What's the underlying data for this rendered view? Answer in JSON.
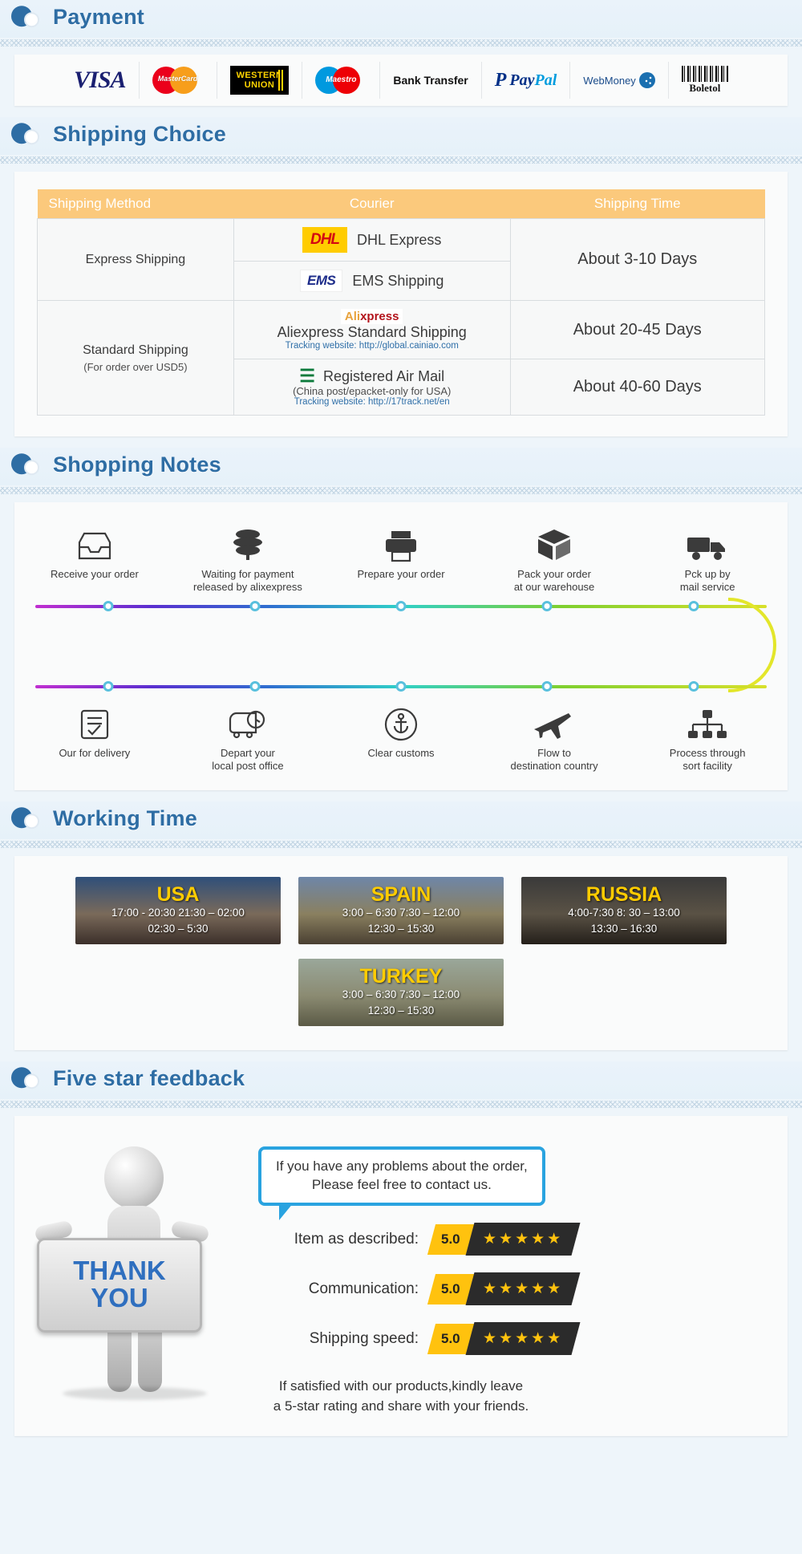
{
  "sections": {
    "payment": {
      "title": "Payment"
    },
    "shipping": {
      "title": "Shipping Choice"
    },
    "notes": {
      "title": "Shopping Notes"
    },
    "working": {
      "title": "Working Time"
    },
    "feedback": {
      "title": "Five star feedback"
    }
  },
  "payment": {
    "methods": [
      {
        "name": "visa-logo",
        "label": "VISA"
      },
      {
        "name": "mastercard-logo",
        "label": "MasterCard"
      },
      {
        "name": "western-union-logo",
        "label": "WESTERN UNION",
        "line1": "WESTERN",
        "line2": "UNION"
      },
      {
        "name": "maestro-logo",
        "label": "Maestro"
      },
      {
        "name": "bank-transfer-logo",
        "label": "Bank Transfer"
      },
      {
        "name": "paypal-logo",
        "label": "PayPal",
        "mark": "P",
        "part1": "Pay",
        "part2": "Pal"
      },
      {
        "name": "webmoney-logo",
        "label": "WebMoney"
      },
      {
        "name": "boleto-logo",
        "label": "Boletol"
      }
    ]
  },
  "shipping_table": {
    "headers": [
      "Shipping Method",
      "Courier",
      "Shipping Time"
    ],
    "rows": [
      {
        "method": "Express Shipping",
        "method_sub": "",
        "time": "About 3-10 Days",
        "couriers": [
          {
            "logo": "dhl-logo",
            "logo_text": "DHL",
            "name": "DHL Express",
            "sub": "",
            "tracking": ""
          },
          {
            "logo": "ems-logo",
            "logo_text": "EMS",
            "name": "EMS Shipping",
            "sub": "",
            "tracking": ""
          }
        ]
      },
      {
        "method": "Standard Shipping",
        "method_sub": "(For order over USD5)",
        "time": "About 20-45 Days",
        "couriers": [
          {
            "logo": "aliexpress-logo",
            "logo_text": "AliExpress",
            "name": "Aliexpress Standard Shipping",
            "sub": "",
            "tracking": "Tracking website: http://global.cainiao.com"
          }
        ]
      },
      {
        "method": "",
        "method_sub": "",
        "time": "About 40-60 Days",
        "couriers": [
          {
            "logo": "china-post-logo",
            "logo_text": "China Post",
            "name": "Registered Air Mail",
            "sub": "(China post/epacket-only for USA)",
            "tracking": "Tracking website: http://17track.net/en"
          }
        ]
      }
    ]
  },
  "shopping_notes": {
    "top_steps": [
      {
        "icon": "inbox-tray-icon",
        "label": "Receive your order"
      },
      {
        "icon": "coins-stack-icon",
        "label": "Waiting for payment\nreleased by alixexpress"
      },
      {
        "icon": "printer-icon",
        "label": "Prepare your order"
      },
      {
        "icon": "package-box-icon",
        "label": "Pack your order\nat our warehouse"
      },
      {
        "icon": "delivery-truck-icon",
        "label": "Pck up by\nmail service"
      }
    ],
    "bottom_steps": [
      {
        "icon": "checklist-icon",
        "label": "Our for delivery"
      },
      {
        "icon": "truck-clock-icon",
        "label": "Depart your\nlocal post office"
      },
      {
        "icon": "anchor-circle-icon",
        "label": "Clear customs"
      },
      {
        "icon": "airplane-icon",
        "label": "Flow to\ndestination country"
      },
      {
        "icon": "sort-facility-icon",
        "label": "Process through\nsort facility"
      }
    ]
  },
  "working_time": {
    "cards": [
      {
        "country": "USA",
        "times": [
          "17:00  -  20:30   21:30  –  02:00",
          "02:30  –  5:30"
        ]
      },
      {
        "country": "SPAIN",
        "times": [
          "3:00  –   6:30    7:30  –  12:00",
          "12:30  –  15:30"
        ]
      },
      {
        "country": "RUSSIA",
        "times": [
          "4:00-7:30    8:  30  –  13:00",
          "13:30  –  16:30"
        ]
      },
      {
        "country": "TURKEY",
        "times": [
          "3:00  –   6:30    7:30  –  12:00",
          "12:30  –  15:30"
        ]
      }
    ]
  },
  "feedback": {
    "bubble": "If you have any problems about the order,\nPlease feel free to contact us.",
    "sign_line1": "THANK",
    "sign_line2": "YOU",
    "ratings": [
      {
        "label": "Item as described:",
        "score": "5.0",
        "stars": "★★★★★"
      },
      {
        "label": "Communication:",
        "score": "5.0",
        "stars": "★★★★★"
      },
      {
        "label": "Shipping speed:",
        "score": "5.0",
        "stars": "★★★★★"
      }
    ],
    "note": "If satisfied with our products,kindly leave\na 5-star rating and share with your friends."
  },
  "colors": {
    "heading": "#2e6da4",
    "table_header": "#fbc97c",
    "accent_yellow": "#ffc20e",
    "bubble_border": "#29a3e0",
    "link": "#2f6fa8"
  }
}
